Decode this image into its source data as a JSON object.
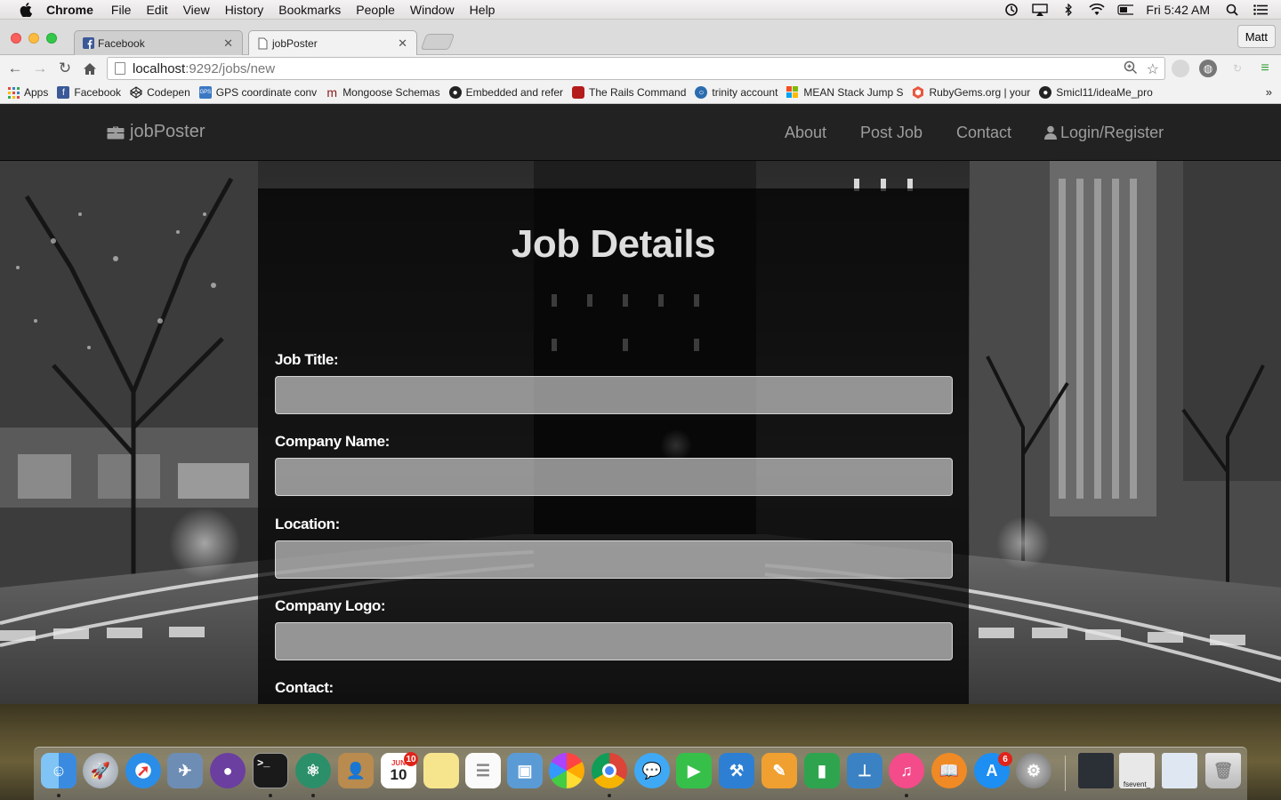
{
  "menubar": {
    "app_name": "Chrome",
    "items": [
      "File",
      "Edit",
      "View",
      "History",
      "Bookmarks",
      "People",
      "Window",
      "Help"
    ],
    "clock": "Fri 5:42 AM"
  },
  "browser": {
    "tabs": [
      {
        "title": "Facebook",
        "icon": "facebook-icon"
      },
      {
        "title": "jobPoster",
        "icon": "page-icon"
      }
    ],
    "profile_name": "Matt",
    "url_host": "localhost",
    "url_rest": ":9292/jobs/new",
    "bookmarks": [
      {
        "label": "Apps",
        "icon": "apps-grid-icon",
        "color": "#e04b3a"
      },
      {
        "label": "Facebook",
        "icon": "facebook-icon",
        "color": "#3b5998"
      },
      {
        "label": "Codepen",
        "icon": "codepen-icon",
        "color": "#222222"
      },
      {
        "label": "GPS coordinate conv",
        "icon": "gps-icon",
        "color": "#3a78c4"
      },
      {
        "label": "Mongoose Schemas",
        "icon": "mongoose-icon",
        "color": "#8b1a1a"
      },
      {
        "label": "Embedded and refer",
        "icon": "github-icon",
        "color": "#222222"
      },
      {
        "label": "The Rails Command",
        "icon": "rails-icon",
        "color": "#b41c1c"
      },
      {
        "label": "trinity account",
        "icon": "trinity-icon",
        "color": "#2b6cb0"
      },
      {
        "label": "MEAN Stack Jump S",
        "icon": "windows-icon",
        "color": "#f25022"
      },
      {
        "label": "RubyGems.org | your",
        "icon": "rubygems-icon",
        "color": "#e9573f"
      },
      {
        "label": "Smicl11/ideaMe_pro",
        "icon": "github-icon",
        "color": "#222222"
      }
    ]
  },
  "site": {
    "brand": "jobPoster",
    "nav": {
      "about": "About",
      "post_job": "Post Job",
      "contact": "Contact",
      "login": "Login/Register"
    }
  },
  "form": {
    "heading": "Job Details",
    "fields": [
      {
        "label": "Job Title:",
        "value": ""
      },
      {
        "label": "Company Name:",
        "value": ""
      },
      {
        "label": "Location:",
        "value": ""
      },
      {
        "label": "Company Logo:",
        "value": ""
      },
      {
        "label": "Contact:",
        "value": ""
      }
    ]
  },
  "dock": {
    "calendar_month": "JUN",
    "calendar_day": "10",
    "calendar_badge": "10",
    "appstore_badge": "6",
    "terminal_thumb_label": "fsevent_",
    "colors": {
      "finder": "#3a8be0",
      "launchpad": "#9aa3ad",
      "safari": "#2a8de8",
      "mail": "#6e8db4",
      "github": "#6b3fa0",
      "terminal": "#1a1a1a",
      "atom": "#3aa57a",
      "contacts": "#b98b4e",
      "calendar": "#ffffff",
      "notes": "#f6e58d",
      "reminders": "#fafafa",
      "preview": "#5b9bd5",
      "photos": "#f3f3f3",
      "chrome": "#db4437",
      "messages": "#3fa9f5",
      "facetime": "#36c04a",
      "xcode": "#2d7fd3",
      "pages": "#f0a030",
      "numbers": "#2ea44f",
      "keynote": "#3b82c4",
      "itunes": "#f44b8b",
      "ibooks": "#f08a24",
      "appstore": "#1d8ef2",
      "sysprefs": "#8a8a8a"
    }
  }
}
